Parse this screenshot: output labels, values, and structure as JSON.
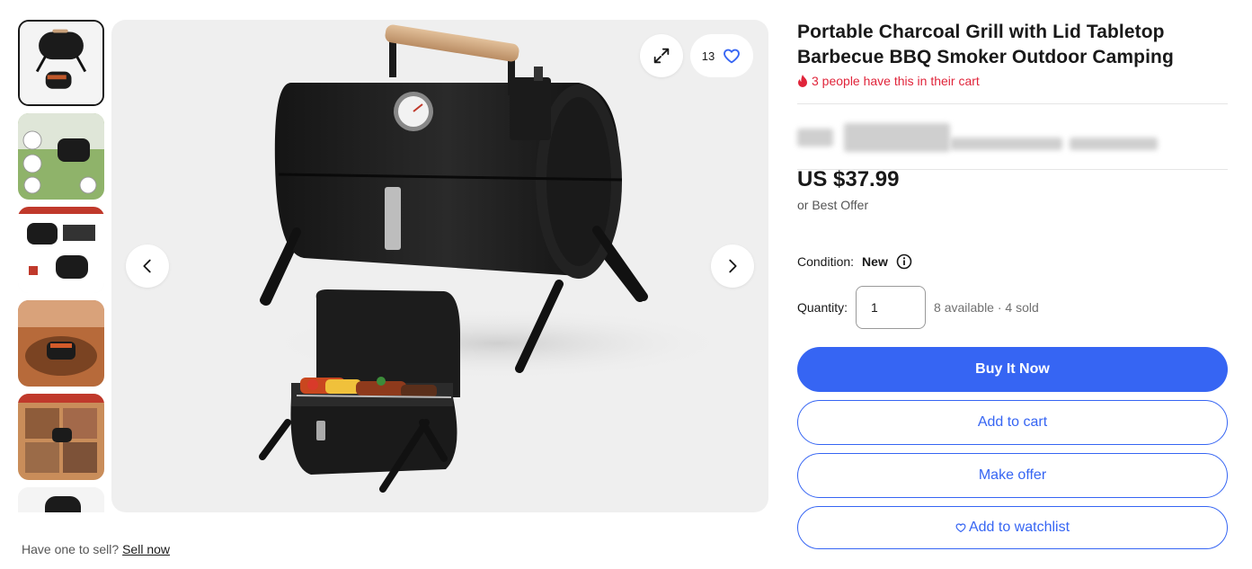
{
  "listing": {
    "title": "Portable Charcoal Grill with Lid Tabletop Barbecue BBQ Smoker Outdoor Camping",
    "cart_alert": "3 people have this in their cart",
    "price": "US $37.99",
    "best_offer": "or Best Offer",
    "condition_label": "Condition:",
    "condition_value": "New",
    "quantity_label": "Quantity:",
    "quantity_value": "1",
    "availability": "8 available · 4 sold"
  },
  "gallery": {
    "watch_count": "13",
    "thumbnail_count": 6,
    "selected_index": 0
  },
  "actions": {
    "buy_now": "Buy It Now",
    "add_to_cart": "Add to cart",
    "make_offer": "Make offer",
    "add_to_watchlist": "Add to watchlist"
  },
  "sell": {
    "prompt": "Have one to sell?",
    "link": "Sell now"
  },
  "colors": {
    "primary_blue": "#3665f3",
    "alert_red": "#e0243a",
    "text": "#191919"
  },
  "icons": [
    "expand-icon",
    "heart-icon",
    "chevron-left-icon",
    "chevron-right-icon",
    "fire-icon",
    "info-icon"
  ]
}
